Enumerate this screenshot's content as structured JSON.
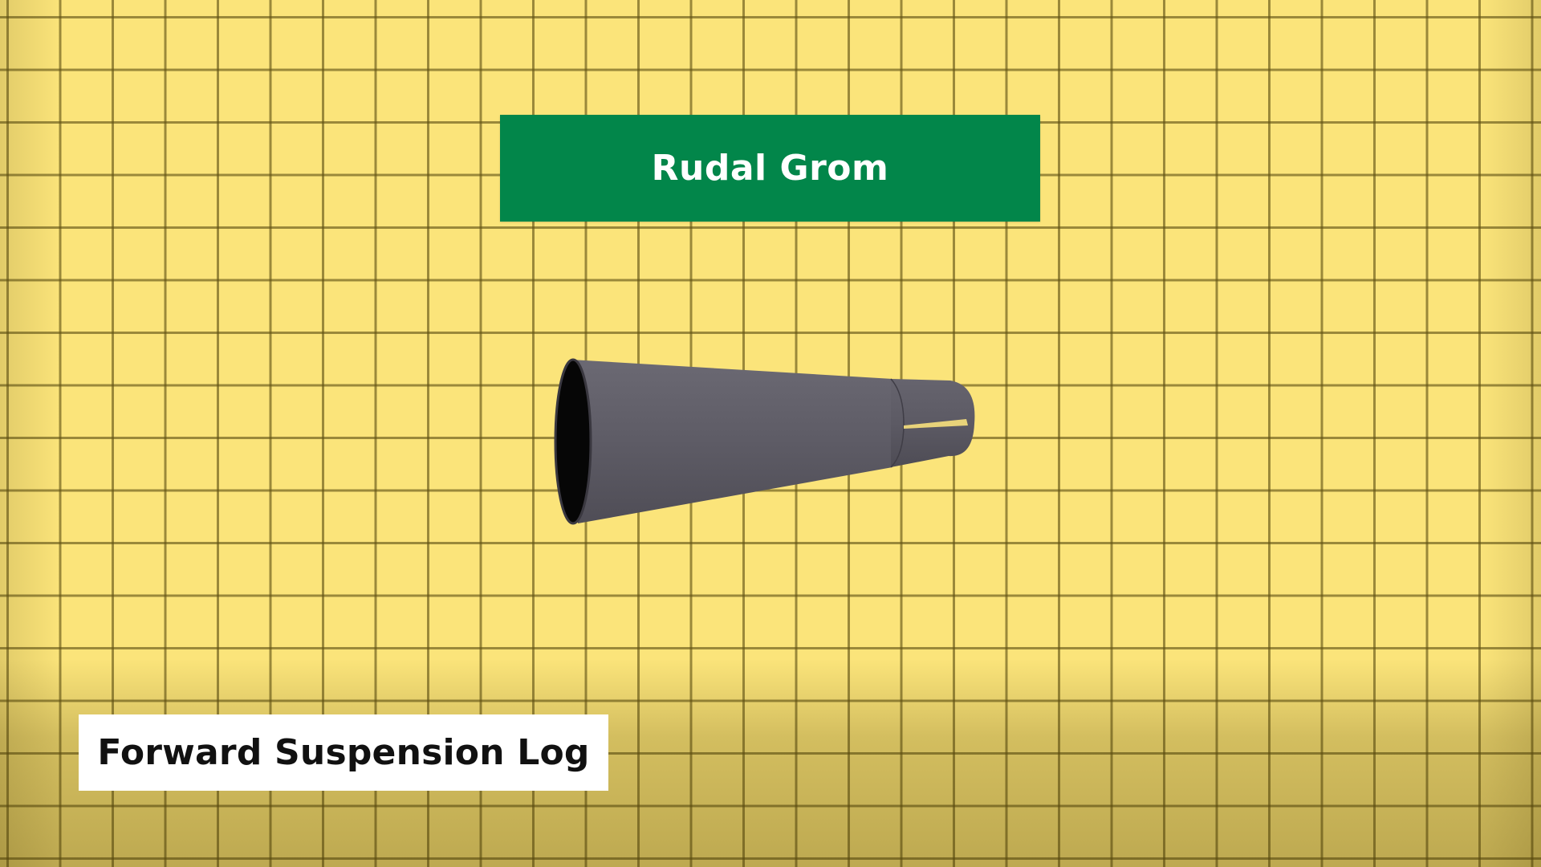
{
  "title_banner": {
    "text": "Rudal Grom",
    "background_color": "#02864a",
    "text_color": "#ffffff"
  },
  "caption": {
    "text": "Forward Suspension Log",
    "background_color": "#ffffff",
    "text_color": "#111111"
  },
  "background": {
    "pattern": "grid",
    "base_color": "#fbe47a",
    "line_color": "#5f5014"
  },
  "object": {
    "name": "tapered-cylinder-tube",
    "body_color": "#5e5c66",
    "opening_color": "#050505"
  }
}
